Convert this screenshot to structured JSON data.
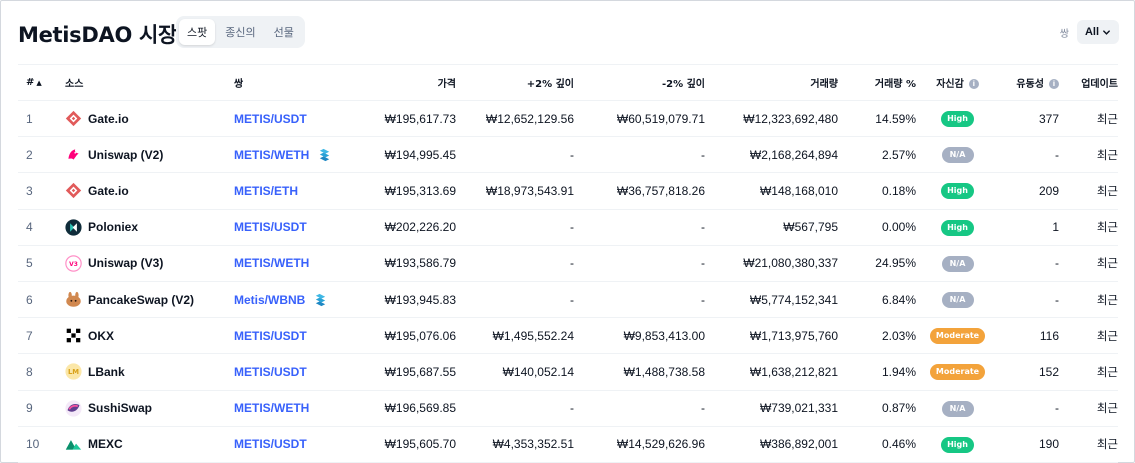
{
  "page": {
    "title": "MetisDAO 시장",
    "tabs": [
      {
        "label": "스팟",
        "active": true
      },
      {
        "label": "종신의",
        "active": false
      },
      {
        "label": "선물",
        "active": false
      }
    ],
    "pair_filter": {
      "label": "쌍",
      "value": "All"
    }
  },
  "colors": {
    "link": "#3861fb",
    "high": "#16c784",
    "moderate": "#f3a33b",
    "na": "#a6b0c3"
  },
  "table": {
    "headers": {
      "rank": "#",
      "source": "소스",
      "pair": "쌍",
      "price": "가격",
      "depth_plus": "+2% 깊이",
      "depth_minus": "-2% 깊이",
      "volume": "거래량",
      "volume_pct": "거래량 %",
      "confidence": "자신감",
      "liquidity": "유동성",
      "updated": "업데이트"
    },
    "rows": [
      {
        "rank": "1",
        "exchange": "Gate.io",
        "logo": "gate-icon",
        "pair": "METIS/USDT",
        "dex": false,
        "price": "₩195,617.73",
        "depth_plus": "₩12,652,129.56",
        "depth_minus": "₩60,519,079.71",
        "volume": "₩12,323,692,480",
        "volume_pct": "14.59%",
        "confidence": "High",
        "liquidity": "377",
        "updated": "최근"
      },
      {
        "rank": "2",
        "exchange": "Uniswap (V2)",
        "logo": "uniswap-icon",
        "pair": "METIS/WETH",
        "dex": true,
        "price": "₩194,995.45",
        "depth_plus": "-",
        "depth_minus": "-",
        "volume": "₩2,168,264,894",
        "volume_pct": "2.57%",
        "confidence": "N/A",
        "liquidity": "-",
        "updated": "최근"
      },
      {
        "rank": "3",
        "exchange": "Gate.io",
        "logo": "gate-icon",
        "pair": "METIS/ETH",
        "dex": false,
        "price": "₩195,313.69",
        "depth_plus": "₩18,973,543.91",
        "depth_minus": "₩36,757,818.26",
        "volume": "₩148,168,010",
        "volume_pct": "0.18%",
        "confidence": "High",
        "liquidity": "209",
        "updated": "최근"
      },
      {
        "rank": "4",
        "exchange": "Poloniex",
        "logo": "poloniex-icon",
        "pair": "METIS/USDT",
        "dex": false,
        "price": "₩202,226.20",
        "depth_plus": "-",
        "depth_minus": "-",
        "volume": "₩567,795",
        "volume_pct": "0.00%",
        "confidence": "High",
        "liquidity": "1",
        "updated": "최근"
      },
      {
        "rank": "5",
        "exchange": "Uniswap (V3)",
        "logo": "uniswap-v3-icon",
        "pair": "METIS/WETH",
        "dex": false,
        "price": "₩193,586.79",
        "depth_plus": "-",
        "depth_minus": "-",
        "volume": "₩21,080,380,337",
        "volume_pct": "24.95%",
        "confidence": "N/A",
        "liquidity": "-",
        "updated": "최근"
      },
      {
        "rank": "6",
        "exchange": "PancakeSwap (V2)",
        "logo": "pancakeswap-icon",
        "pair": "Metis/WBNB",
        "dex": true,
        "price": "₩193,945.83",
        "depth_plus": "-",
        "depth_minus": "-",
        "volume": "₩5,774,152,341",
        "volume_pct": "6.84%",
        "confidence": "N/A",
        "liquidity": "-",
        "updated": "최근"
      },
      {
        "rank": "7",
        "exchange": "OKX",
        "logo": "okx-icon",
        "pair": "METIS/USDT",
        "dex": false,
        "price": "₩195,076.06",
        "depth_plus": "₩1,495,552.24",
        "depth_minus": "₩9,853,413.00",
        "volume": "₩1,713,975,760",
        "volume_pct": "2.03%",
        "confidence": "Moderate",
        "liquidity": "116",
        "updated": "최근"
      },
      {
        "rank": "8",
        "exchange": "LBank",
        "logo": "lbank-icon",
        "pair": "METIS/USDT",
        "dex": false,
        "price": "₩195,687.55",
        "depth_plus": "₩140,052.14",
        "depth_minus": "₩1,488,738.58",
        "volume": "₩1,638,212,821",
        "volume_pct": "1.94%",
        "confidence": "Moderate",
        "liquidity": "152",
        "updated": "최근"
      },
      {
        "rank": "9",
        "exchange": "SushiSwap",
        "logo": "sushiswap-icon",
        "pair": "METIS/WETH",
        "dex": false,
        "price": "₩196,569.85",
        "depth_plus": "-",
        "depth_minus": "-",
        "volume": "₩739,021,331",
        "volume_pct": "0.87%",
        "confidence": "N/A",
        "liquidity": "-",
        "updated": "최근"
      },
      {
        "rank": "10",
        "exchange": "MEXC",
        "logo": "mexc-icon",
        "pair": "METIS/USDT",
        "dex": false,
        "price": "₩195,605.70",
        "depth_plus": "₩4,353,352.51",
        "depth_minus": "₩14,529,626.96",
        "volume": "₩386,892,001",
        "volume_pct": "0.46%",
        "confidence": "High",
        "liquidity": "190",
        "updated": "최근"
      }
    ]
  }
}
